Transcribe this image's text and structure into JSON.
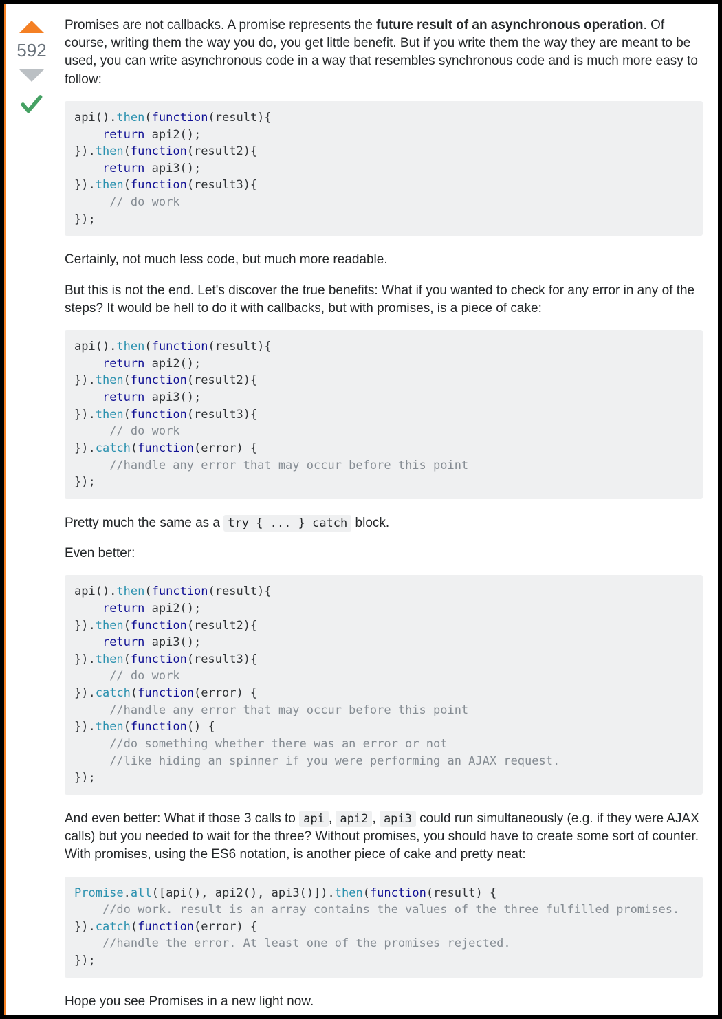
{
  "vote": {
    "count": "592"
  },
  "paragraphs": {
    "p1_pre": "Promises are not callbacks. A promise represents the ",
    "p1_bold": "future result of an asynchronous operation",
    "p1_post": ". Of course, writing them the way you do, you get little benefit. But if you write them the way they are meant to be used, you can write asynchronous code in a way that resembles synchronous code and is much more easy to follow:",
    "p2": "Certainly, not much less code, but much more readable.",
    "p3": "But this is not the end. Let's discover the true benefits: What if you wanted to check for any error in any of the steps? It would be hell to do it with callbacks, but with promises, is a piece of cake:",
    "p4_pre": "Pretty much the same as a ",
    "p4_code": "try { ... } catch",
    "p4_post": " block.",
    "p5": "Even better:",
    "p6_pre": "And even better: What if those 3 calls to ",
    "p6_c1": "api",
    "p6_m1": ", ",
    "p6_c2": "api2",
    "p6_m2": ", ",
    "p6_c3": "api3",
    "p6_post": " could run simultaneously (e.g. if they were AJAX calls) but you needed to wait for the three? Without promises, you should have to create some sort of counter. With promises, using the ES6 notation, is another piece of cake and pretty neat:",
    "p7": "Hope you see Promises in a new light now."
  },
  "code": {
    "block1": "api().then(function(result){\n    return api2();\n}).then(function(result2){\n    return api3();\n}).then(function(result3){\n     // do work\n});",
    "block2": "api().then(function(result){\n    return api2();\n}).then(function(result2){\n    return api3();\n}).then(function(result3){\n     // do work\n}).catch(function(error) {\n     //handle any error that may occur before this point\n});",
    "block3": "api().then(function(result){\n    return api2();\n}).then(function(result2){\n    return api3();\n}).then(function(result3){\n     // do work\n}).catch(function(error) {\n     //handle any error that may occur before this point\n}).then(function() {\n     //do something whether there was an error or not\n     //like hiding an spinner if you were performing an AJAX request.\n});",
    "block4": "Promise.all([api(), api2(), api3()]).then(function(result) {\n    //do work. result is an array contains the values of the three fulfilled promises.\n}).catch(function(error) {\n    //handle the error. At least one of the promises rejected.\n});"
  }
}
